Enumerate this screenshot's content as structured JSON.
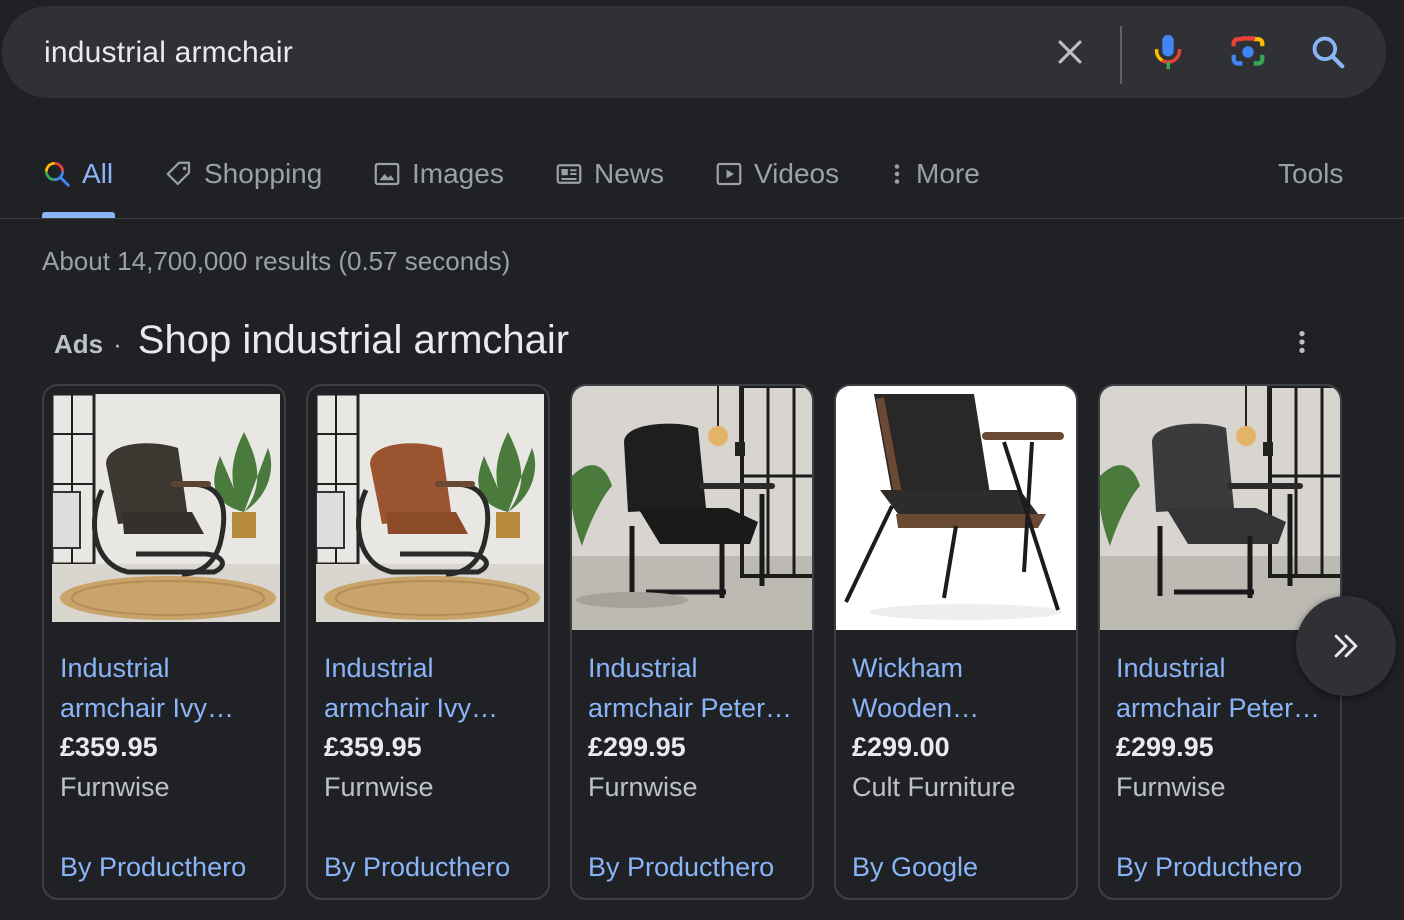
{
  "search": {
    "query": "industrial armchair"
  },
  "tabs": [
    {
      "label": "All",
      "icon": "search-icon"
    },
    {
      "label": "Shopping",
      "icon": "tag-icon"
    },
    {
      "label": "Images",
      "icon": "image-icon"
    },
    {
      "label": "News",
      "icon": "newspaper-icon"
    },
    {
      "label": "Videos",
      "icon": "play-icon"
    },
    {
      "label": "More",
      "icon": "kebab-icon"
    }
  ],
  "tools_label": "Tools",
  "result_stats": "About 14,700,000 results (0.57 seconds)",
  "ads": {
    "label": "Ads",
    "separator": "·",
    "title": "Shop industrial armchair"
  },
  "products": [
    {
      "title_line1": "Industrial",
      "title_line2": "armchair Ivy…",
      "price": "£359.95",
      "merchant": "Furnwise",
      "by": "By Producthero"
    },
    {
      "title_line1": "Industrial",
      "title_line2": "armchair Ivy…",
      "price": "£359.95",
      "merchant": "Furnwise",
      "by": "By Producthero"
    },
    {
      "title_line1": "Industrial",
      "title_line2": "armchair Peter…",
      "price": "£299.95",
      "merchant": "Furnwise",
      "by": "By Producthero"
    },
    {
      "title_line1": "Wickham",
      "title_line2": "Wooden…",
      "price": "£299.00",
      "merchant": "Cult Furniture",
      "by": "By Google"
    },
    {
      "title_line1": "Industrial",
      "title_line2": "armchair Peter…",
      "price": "£299.95",
      "merchant": "Furnwise",
      "by": "By Producthero"
    }
  ],
  "colors": {
    "background": "#202124",
    "link": "#8ab4f8",
    "muted": "#9aa0a6"
  }
}
